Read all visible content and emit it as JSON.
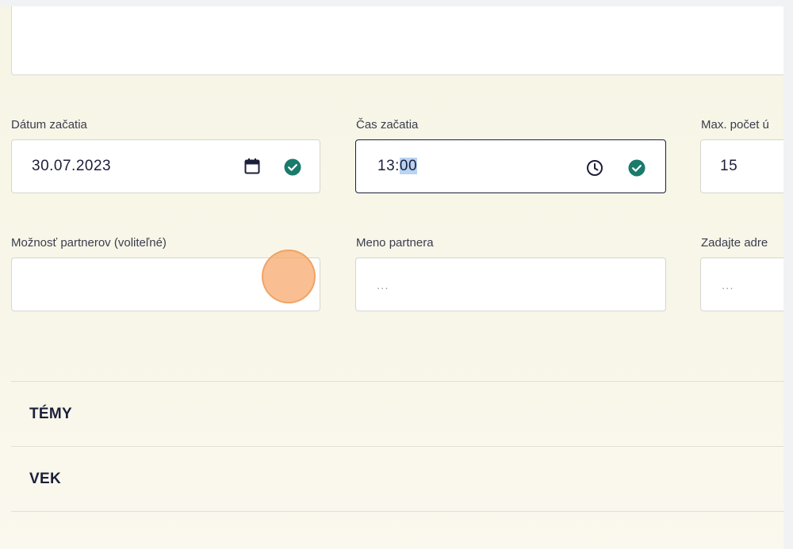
{
  "form": {
    "start_date": {
      "label": "Dátum začatia",
      "value": "30.07.2023"
    },
    "start_time": {
      "label": "Čas začatia",
      "value_hour": "13:",
      "value_minute_selected": "00"
    },
    "max_count": {
      "label": "Max. počet ú",
      "value": "15"
    },
    "partner_option": {
      "label": "Možnosť partnerov (voliteľné)",
      "value": ""
    },
    "partner_name": {
      "label": "Meno partnera",
      "placeholder": "..."
    },
    "address": {
      "label": "Zadajte adre",
      "placeholder": "..."
    }
  },
  "sections": [
    {
      "title": "TÉMY"
    },
    {
      "title": "VEK"
    }
  ],
  "icons": {
    "calendar": "calendar-icon",
    "clock": "clock-icon",
    "check": "check-circle-icon"
  },
  "colors": {
    "check_green": "#1a7a6c",
    "text_dark": "#1c1f3a",
    "selection": "#b9d3f2",
    "click_indicator": "#f7aa6e"
  }
}
